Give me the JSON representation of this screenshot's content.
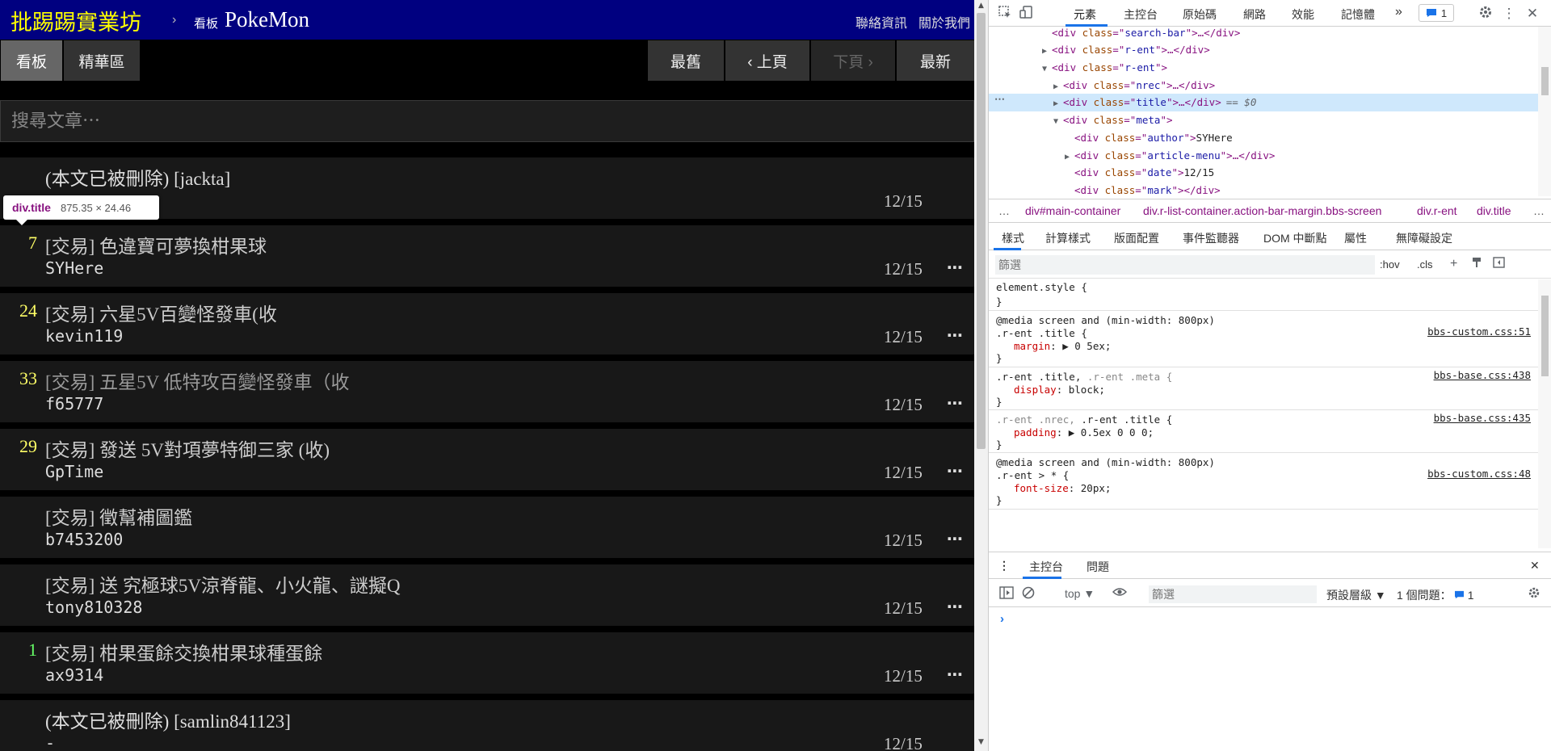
{
  "ptt": {
    "site_title": "批踢踢實業坊",
    "crumb_separator": "›",
    "crumb_type": "看板",
    "board_name": "PokeMon",
    "links": {
      "contact": "聯絡資訊",
      "about": "關於我們"
    },
    "tabs": {
      "board": "看板",
      "digest": "精華區"
    },
    "paging": {
      "oldest": "最舊",
      "prev": "‹ 上頁",
      "next": "下頁 ›",
      "newest": "最新"
    },
    "search_placeholder": "搜尋文章⋯",
    "posts": [
      {
        "nrec": "",
        "nrec_color": "#dddddd",
        "title": "(本文已被刪除) [jackta]",
        "author": "-",
        "date": "12/15",
        "menu": "",
        "title_color": "#dddddd"
      },
      {
        "nrec": "7",
        "nrec_color": "#ffff66",
        "title": "[交易] 色違寶可夢換柑果球",
        "author": "SYHere",
        "date": "12/15",
        "menu": "⋯",
        "title_color": "#cccccc"
      },
      {
        "nrec": "24",
        "nrec_color": "#ffff66",
        "title": "[交易] 六星5V百變怪發車(收",
        "author": "kevin119",
        "date": "12/15",
        "menu": "⋯",
        "title_color": "#cccccc"
      },
      {
        "nrec": "33",
        "nrec_color": "#ffff66",
        "title": "[交易] 五星5V 低特攻百變怪發車（收",
        "author": "f65777",
        "date": "12/15",
        "menu": "⋯",
        "title_color": "#999999"
      },
      {
        "nrec": "29",
        "nrec_color": "#ffff66",
        "title": "[交易] 發送 5V對項夢特御三家 (收)",
        "author": "GpTime",
        "date": "12/15",
        "menu": "⋯",
        "title_color": "#cccccc"
      },
      {
        "nrec": "",
        "nrec_color": "#dddddd",
        "title": "[交易] 徵幫補圖鑑",
        "author": "b7453200",
        "date": "12/15",
        "menu": "⋯",
        "title_color": "#cccccc"
      },
      {
        "nrec": "",
        "nrec_color": "#dddddd",
        "title": "[交易] 送 究極球5V涼脊龍、小火龍、謎擬Q",
        "author": "tony810328",
        "date": "12/15",
        "menu": "⋯",
        "title_color": "#cccccc"
      },
      {
        "nrec": "1",
        "nrec_color": "#66ff66",
        "title": "[交易] 柑果蛋餘交換柑果球種蛋餘",
        "author": "ax9314",
        "date": "12/15",
        "menu": "⋯",
        "title_color": "#cccccc"
      },
      {
        "nrec": "",
        "nrec_color": "#dddddd",
        "title": "(本文已被刪除) [samlin841123]",
        "author": "-",
        "date": "12/15",
        "menu": "",
        "title_color": "#dddddd"
      }
    ],
    "inspect_tooltip": {
      "tag": "div.title",
      "size": "875.35 × 24.46"
    }
  },
  "devtools": {
    "tabs": [
      "元素",
      "主控台",
      "原始碼",
      "網路",
      "效能",
      "記憶體"
    ],
    "more": "»",
    "issue_count": "1",
    "dom_lines": [
      {
        "open": "",
        "tag": "div",
        "cls": "search-bar",
        "tail": ">…</",
        "text": "",
        "eq": ""
      },
      {
        "open": "▶",
        "tag": "div",
        "cls": "r-ent",
        "tail": ">…</",
        "text": "",
        "eq": ""
      },
      {
        "open": "▼",
        "tag": "div",
        "cls": "r-ent",
        "tail": ">",
        "text": "",
        "eq": ""
      },
      {
        "open": "▶",
        "tag": "div",
        "cls": "nrec",
        "tail": ">…</",
        "text": "",
        "eq": ""
      },
      {
        "open": "▶",
        "tag": "div",
        "cls": "title",
        "tail": ">…</",
        "text": "",
        "eq": "== $0"
      },
      {
        "open": "▼",
        "tag": "div",
        "cls": "meta",
        "tail": ">",
        "text": "",
        "eq": ""
      },
      {
        "open": "",
        "tag": "div",
        "cls": "author",
        "tail": ">",
        "text": "SYHere",
        "eq": ""
      },
      {
        "open": "▶",
        "tag": "div",
        "cls": "article-menu",
        "tail": ">…</",
        "text": "",
        "eq": ""
      },
      {
        "open": "",
        "tag": "div",
        "cls": "date",
        "tail": ">",
        "text": "12/15",
        "eq": ""
      },
      {
        "open": "",
        "tag": "div",
        "cls": "mark",
        "tail": "></",
        "text": "",
        "eq": ""
      }
    ],
    "dom_ellipsis": "⋯",
    "breadcrumbs": [
      "…",
      "div#main-container",
      "div.r-list-container.action-bar-margin.bbs-screen",
      "div.r-ent",
      "div.title",
      "…"
    ],
    "style_tabs": [
      "樣式",
      "計算樣式",
      "版面配置",
      "事件監聽器",
      "DOM 中斷點",
      "屬性",
      "無障礙設定"
    ],
    "styles_filter_placeholder": "篩選",
    "hov": ":hov",
    "cls": ".cls",
    "rules": {
      "r0": {
        "sel": "element.style {",
        "close": "}"
      },
      "r1": {
        "media": "@media screen and (min-width: 800px)",
        "sel": ".r-ent .title {",
        "prop": "margin",
        "val": ": ▶ 0 5ex;",
        "src": "bbs-custom.css:51",
        "close": "}"
      },
      "r2": {
        "sel_dim": ".r-ent .title,",
        "sel_dim2": " .r-ent .meta {",
        "prop": "display",
        "val": ": block;",
        "src": "bbs-base.css:438",
        "close": "}"
      },
      "r3": {
        "sel_dim": ".r-ent .nrec,",
        "sel_dim2": " .r-ent .title {",
        "prop": "padding",
        "val": ": ▶ 0.5ex 0 0 0;",
        "src": "bbs-base.css:435",
        "close": "}"
      },
      "r4": {
        "media": "@media screen and (min-width: 800px)",
        "sel": ".r-ent > * {",
        "prop": "font-size",
        "val": ": 20px;",
        "src": "bbs-custom.css:48",
        "close": "}"
      }
    },
    "console_tabs": [
      "主控台",
      "問題"
    ],
    "console_context": "top ▼",
    "console_filter_placeholder": "篩選",
    "console_levels": "預設層級 ▼",
    "console_issues": "1 個問題：",
    "console_issue_count": "1",
    "prompt": "›"
  }
}
